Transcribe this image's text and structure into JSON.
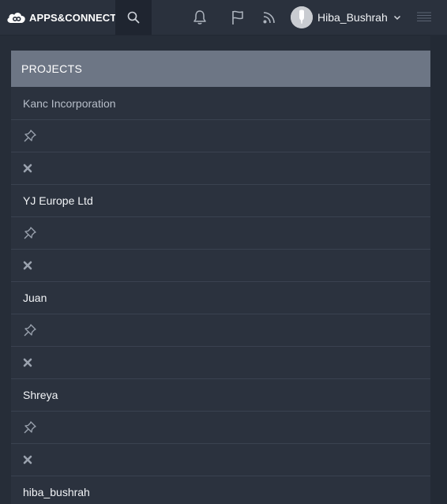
{
  "header": {
    "brand": "APPS&CONNECT",
    "user_name": "Hiba_Bushrah",
    "icons": {
      "search": "search-icon",
      "notifications": "bell-icon",
      "flag": "flag-icon",
      "feed": "rss-icon",
      "menu": "hamburger-menu-icon"
    }
  },
  "panel": {
    "title": "PROJECTS",
    "projects": [
      {
        "name": "Kanc Incorporation"
      },
      {
        "name": "YJ Europe Ltd"
      },
      {
        "name": "Juan"
      },
      {
        "name": "Shreya"
      },
      {
        "name": "hiba_bushrah"
      }
    ]
  },
  "colors": {
    "background": "#262d38",
    "topbar": "#2a313d",
    "panel_header": "#6d7685",
    "panel_body": "#2b323e"
  }
}
